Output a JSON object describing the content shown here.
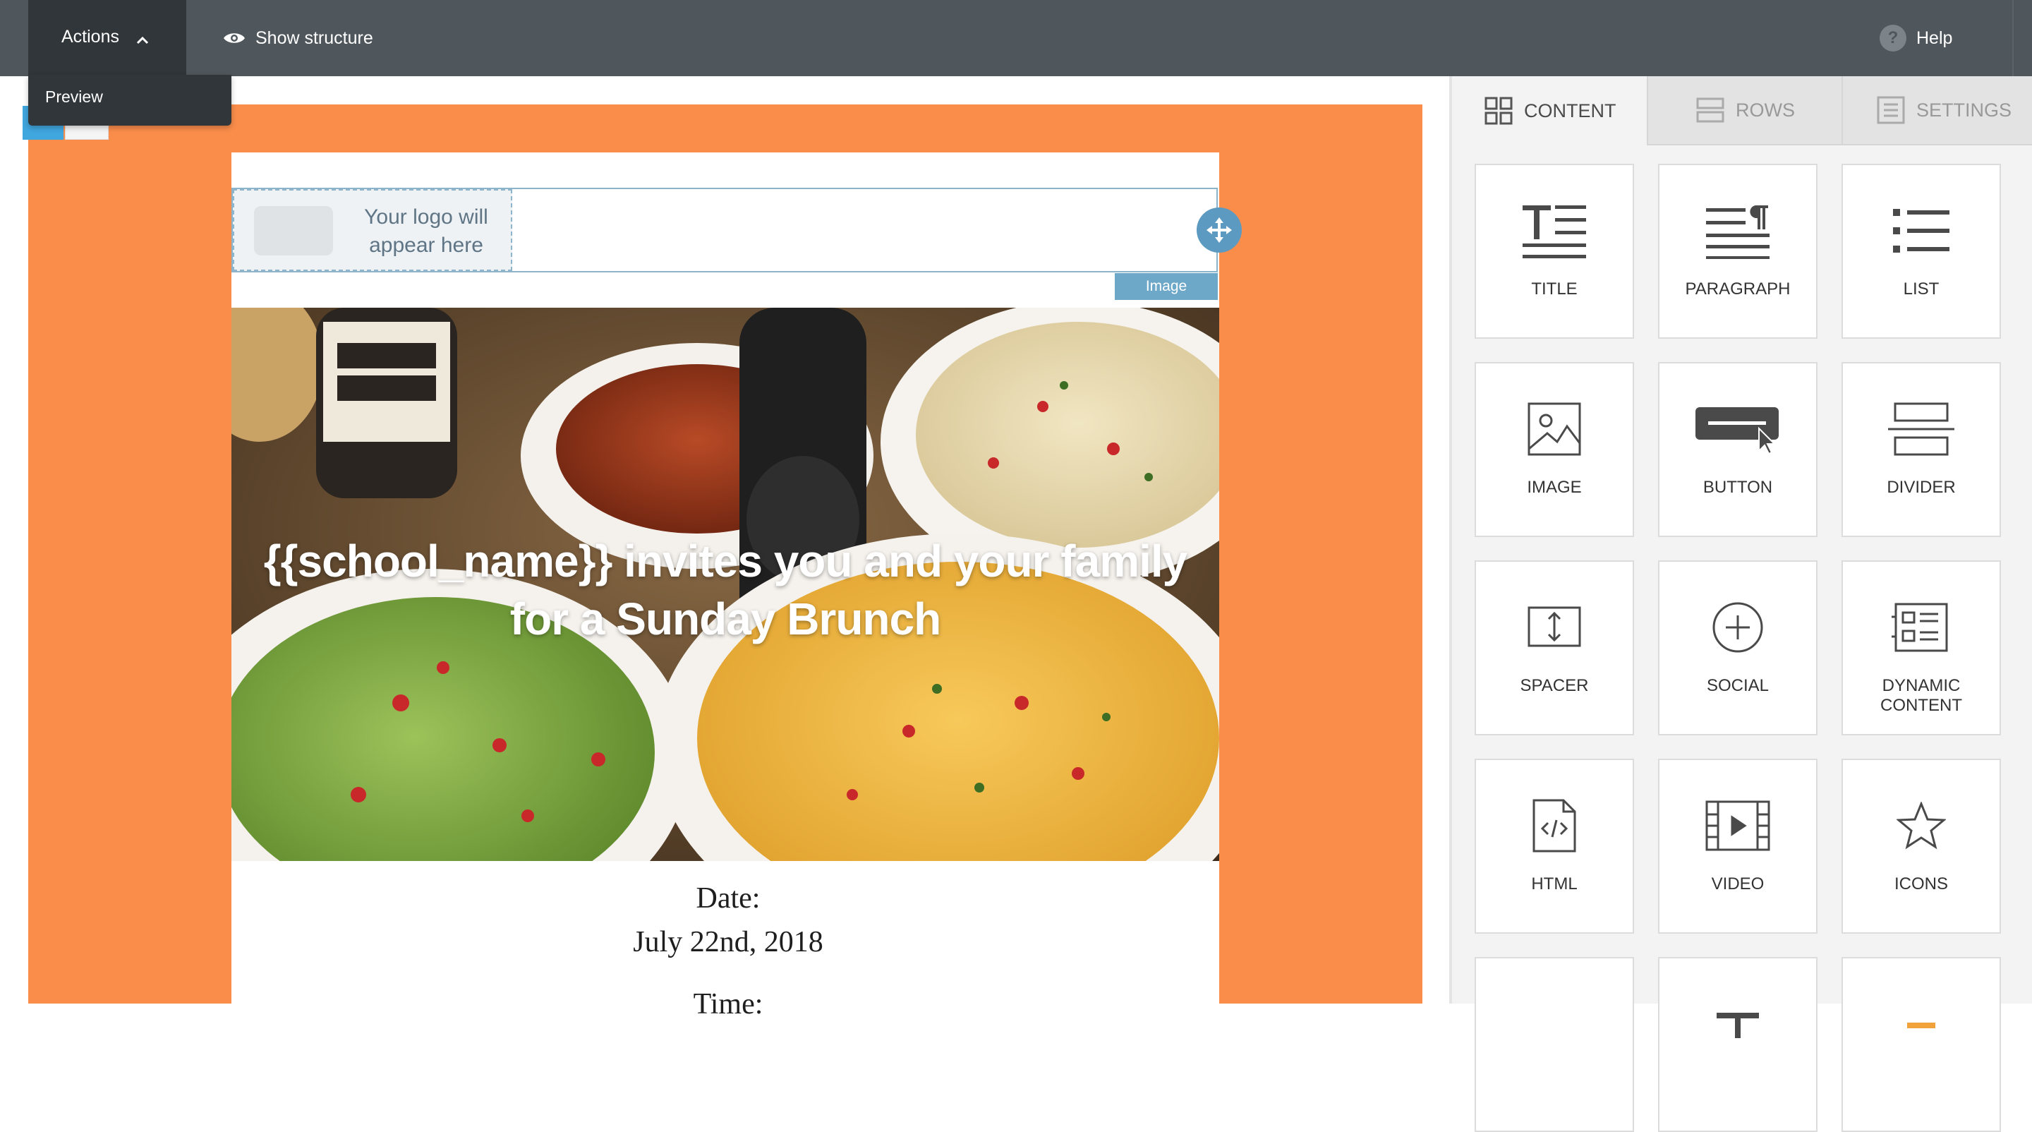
{
  "topbar": {
    "actions_label": "Actions",
    "show_structure_label": "Show structure",
    "help_label": "Help",
    "help_badge": "?"
  },
  "actions_menu": {
    "items": [
      "Preview"
    ]
  },
  "email": {
    "logo_placeholder": "Your logo will appear here",
    "image_tag": "Image",
    "hero_title": "{{school_name}}  invites you  and your family for a Sunday Brunch",
    "date_label": "Date:",
    "date_value": "July 22nd, 2018",
    "time_label": "Time:",
    "background_color": "#fa8d4a"
  },
  "sidebar": {
    "tabs": [
      {
        "label": "CONTENT",
        "icon": "content-grid-icon",
        "active": true
      },
      {
        "label": "ROWS",
        "icon": "rows-icon",
        "active": false
      },
      {
        "label": "SETTINGS",
        "icon": "settings-icon",
        "active": false
      }
    ],
    "blocks": [
      {
        "label": "TITLE",
        "icon": "title-icon"
      },
      {
        "label": "PARAGRAPH",
        "icon": "paragraph-icon"
      },
      {
        "label": "LIST",
        "icon": "list-icon"
      },
      {
        "label": "IMAGE",
        "icon": "image-icon"
      },
      {
        "label": "BUTTON",
        "icon": "button-icon"
      },
      {
        "label": "DIVIDER",
        "icon": "divider-icon"
      },
      {
        "label": "SPACER",
        "icon": "spacer-icon"
      },
      {
        "label": "SOCIAL",
        "icon": "social-icon"
      },
      {
        "label": "DYNAMIC CONTENT",
        "icon": "dynamic-content-icon"
      },
      {
        "label": "HTML",
        "icon": "html-icon"
      },
      {
        "label": "VIDEO",
        "icon": "video-icon"
      },
      {
        "label": "ICONS",
        "icon": "star-icon"
      }
    ]
  }
}
